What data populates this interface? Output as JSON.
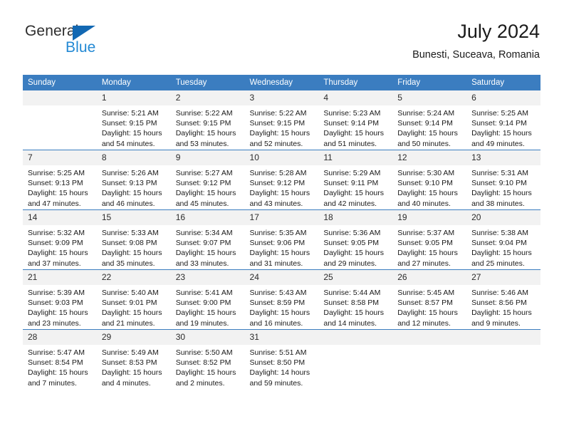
{
  "brand": {
    "name_top": "General",
    "name_bottom": "Blue",
    "accent_color": "#2389d4",
    "triangle_color": "#1268b3"
  },
  "header": {
    "title": "July 2024",
    "subtitle": "Bunesti, Suceava, Romania"
  },
  "theme": {
    "header_bg": "#3b7dc0",
    "daynum_bg": "#f2f2f2",
    "grid_line": "#3b7dc0"
  },
  "calendar": {
    "weekday_headers": [
      "Sunday",
      "Monday",
      "Tuesday",
      "Wednesday",
      "Thursday",
      "Friday",
      "Saturday"
    ],
    "weeks": [
      [
        {
          "day": "",
          "sunrise": "",
          "sunset": "",
          "daylight_line1": "",
          "daylight_line2": ""
        },
        {
          "day": "1",
          "sunrise": "Sunrise: 5:21 AM",
          "sunset": "Sunset: 9:15 PM",
          "daylight_line1": "Daylight: 15 hours",
          "daylight_line2": "and 54 minutes."
        },
        {
          "day": "2",
          "sunrise": "Sunrise: 5:22 AM",
          "sunset": "Sunset: 9:15 PM",
          "daylight_line1": "Daylight: 15 hours",
          "daylight_line2": "and 53 minutes."
        },
        {
          "day": "3",
          "sunrise": "Sunrise: 5:22 AM",
          "sunset": "Sunset: 9:15 PM",
          "daylight_line1": "Daylight: 15 hours",
          "daylight_line2": "and 52 minutes."
        },
        {
          "day": "4",
          "sunrise": "Sunrise: 5:23 AM",
          "sunset": "Sunset: 9:14 PM",
          "daylight_line1": "Daylight: 15 hours",
          "daylight_line2": "and 51 minutes."
        },
        {
          "day": "5",
          "sunrise": "Sunrise: 5:24 AM",
          "sunset": "Sunset: 9:14 PM",
          "daylight_line1": "Daylight: 15 hours",
          "daylight_line2": "and 50 minutes."
        },
        {
          "day": "6",
          "sunrise": "Sunrise: 5:25 AM",
          "sunset": "Sunset: 9:14 PM",
          "daylight_line1": "Daylight: 15 hours",
          "daylight_line2": "and 49 minutes."
        }
      ],
      [
        {
          "day": "7",
          "sunrise": "Sunrise: 5:25 AM",
          "sunset": "Sunset: 9:13 PM",
          "daylight_line1": "Daylight: 15 hours",
          "daylight_line2": "and 47 minutes."
        },
        {
          "day": "8",
          "sunrise": "Sunrise: 5:26 AM",
          "sunset": "Sunset: 9:13 PM",
          "daylight_line1": "Daylight: 15 hours",
          "daylight_line2": "and 46 minutes."
        },
        {
          "day": "9",
          "sunrise": "Sunrise: 5:27 AM",
          "sunset": "Sunset: 9:12 PM",
          "daylight_line1": "Daylight: 15 hours",
          "daylight_line2": "and 45 minutes."
        },
        {
          "day": "10",
          "sunrise": "Sunrise: 5:28 AM",
          "sunset": "Sunset: 9:12 PM",
          "daylight_line1": "Daylight: 15 hours",
          "daylight_line2": "and 43 minutes."
        },
        {
          "day": "11",
          "sunrise": "Sunrise: 5:29 AM",
          "sunset": "Sunset: 9:11 PM",
          "daylight_line1": "Daylight: 15 hours",
          "daylight_line2": "and 42 minutes."
        },
        {
          "day": "12",
          "sunrise": "Sunrise: 5:30 AM",
          "sunset": "Sunset: 9:10 PM",
          "daylight_line1": "Daylight: 15 hours",
          "daylight_line2": "and 40 minutes."
        },
        {
          "day": "13",
          "sunrise": "Sunrise: 5:31 AM",
          "sunset": "Sunset: 9:10 PM",
          "daylight_line1": "Daylight: 15 hours",
          "daylight_line2": "and 38 minutes."
        }
      ],
      [
        {
          "day": "14",
          "sunrise": "Sunrise: 5:32 AM",
          "sunset": "Sunset: 9:09 PM",
          "daylight_line1": "Daylight: 15 hours",
          "daylight_line2": "and 37 minutes."
        },
        {
          "day": "15",
          "sunrise": "Sunrise: 5:33 AM",
          "sunset": "Sunset: 9:08 PM",
          "daylight_line1": "Daylight: 15 hours",
          "daylight_line2": "and 35 minutes."
        },
        {
          "day": "16",
          "sunrise": "Sunrise: 5:34 AM",
          "sunset": "Sunset: 9:07 PM",
          "daylight_line1": "Daylight: 15 hours",
          "daylight_line2": "and 33 minutes."
        },
        {
          "day": "17",
          "sunrise": "Sunrise: 5:35 AM",
          "sunset": "Sunset: 9:06 PM",
          "daylight_line1": "Daylight: 15 hours",
          "daylight_line2": "and 31 minutes."
        },
        {
          "day": "18",
          "sunrise": "Sunrise: 5:36 AM",
          "sunset": "Sunset: 9:05 PM",
          "daylight_line1": "Daylight: 15 hours",
          "daylight_line2": "and 29 minutes."
        },
        {
          "day": "19",
          "sunrise": "Sunrise: 5:37 AM",
          "sunset": "Sunset: 9:05 PM",
          "daylight_line1": "Daylight: 15 hours",
          "daylight_line2": "and 27 minutes."
        },
        {
          "day": "20",
          "sunrise": "Sunrise: 5:38 AM",
          "sunset": "Sunset: 9:04 PM",
          "daylight_line1": "Daylight: 15 hours",
          "daylight_line2": "and 25 minutes."
        }
      ],
      [
        {
          "day": "21",
          "sunrise": "Sunrise: 5:39 AM",
          "sunset": "Sunset: 9:03 PM",
          "daylight_line1": "Daylight: 15 hours",
          "daylight_line2": "and 23 minutes."
        },
        {
          "day": "22",
          "sunrise": "Sunrise: 5:40 AM",
          "sunset": "Sunset: 9:01 PM",
          "daylight_line1": "Daylight: 15 hours",
          "daylight_line2": "and 21 minutes."
        },
        {
          "day": "23",
          "sunrise": "Sunrise: 5:41 AM",
          "sunset": "Sunset: 9:00 PM",
          "daylight_line1": "Daylight: 15 hours",
          "daylight_line2": "and 19 minutes."
        },
        {
          "day": "24",
          "sunrise": "Sunrise: 5:43 AM",
          "sunset": "Sunset: 8:59 PM",
          "daylight_line1": "Daylight: 15 hours",
          "daylight_line2": "and 16 minutes."
        },
        {
          "day": "25",
          "sunrise": "Sunrise: 5:44 AM",
          "sunset": "Sunset: 8:58 PM",
          "daylight_line1": "Daylight: 15 hours",
          "daylight_line2": "and 14 minutes."
        },
        {
          "day": "26",
          "sunrise": "Sunrise: 5:45 AM",
          "sunset": "Sunset: 8:57 PM",
          "daylight_line1": "Daylight: 15 hours",
          "daylight_line2": "and 12 minutes."
        },
        {
          "day": "27",
          "sunrise": "Sunrise: 5:46 AM",
          "sunset": "Sunset: 8:56 PM",
          "daylight_line1": "Daylight: 15 hours",
          "daylight_line2": "and 9 minutes."
        }
      ],
      [
        {
          "day": "28",
          "sunrise": "Sunrise: 5:47 AM",
          "sunset": "Sunset: 8:54 PM",
          "daylight_line1": "Daylight: 15 hours",
          "daylight_line2": "and 7 minutes."
        },
        {
          "day": "29",
          "sunrise": "Sunrise: 5:49 AM",
          "sunset": "Sunset: 8:53 PM",
          "daylight_line1": "Daylight: 15 hours",
          "daylight_line2": "and 4 minutes."
        },
        {
          "day": "30",
          "sunrise": "Sunrise: 5:50 AM",
          "sunset": "Sunset: 8:52 PM",
          "daylight_line1": "Daylight: 15 hours",
          "daylight_line2": "and 2 minutes."
        },
        {
          "day": "31",
          "sunrise": "Sunrise: 5:51 AM",
          "sunset": "Sunset: 8:50 PM",
          "daylight_line1": "Daylight: 14 hours",
          "daylight_line2": "and 59 minutes."
        },
        {
          "day": "",
          "sunrise": "",
          "sunset": "",
          "daylight_line1": "",
          "daylight_line2": ""
        },
        {
          "day": "",
          "sunrise": "",
          "sunset": "",
          "daylight_line1": "",
          "daylight_line2": ""
        },
        {
          "day": "",
          "sunrise": "",
          "sunset": "",
          "daylight_line1": "",
          "daylight_line2": ""
        }
      ]
    ]
  }
}
